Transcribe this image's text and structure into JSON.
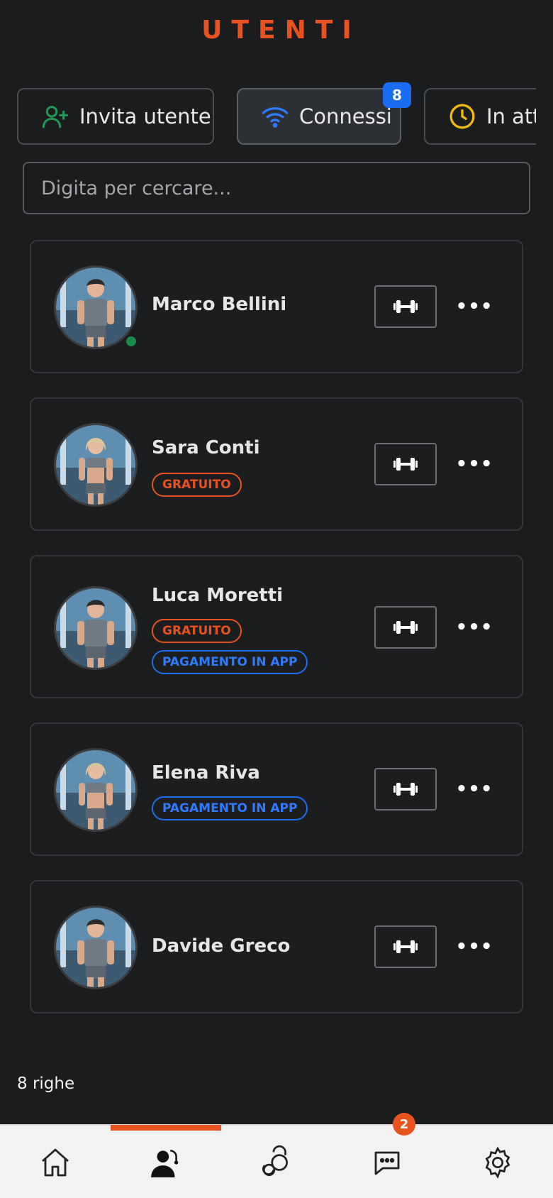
{
  "page": {
    "title": "UTENTI"
  },
  "tabs": {
    "invite_label": "Invita utente",
    "connected_label": "Connessi",
    "connected_count": "8",
    "waiting_label": "In attesa"
  },
  "search": {
    "placeholder": "Digita per cercare..."
  },
  "users": [
    {
      "name": "Marco Bellini",
      "online": true,
      "tags": []
    },
    {
      "name": "Sara Conti",
      "tags": [
        "GRATUITO"
      ]
    },
    {
      "name": "Luca Moretti",
      "tags": [
        "GRATUITO",
        "PAGAMENTO IN APP"
      ]
    },
    {
      "name": "Elena Riva",
      "tags": [
        "PAGAMENTO IN APP"
      ]
    },
    {
      "name": "Davide Greco",
      "tags": []
    }
  ],
  "footer": {
    "rows_count": "8 righe"
  },
  "nav": {
    "active": "users",
    "chat_badge": "2",
    "items": [
      "home-icon",
      "users-icon",
      "kettlebell-icon",
      "chat-icon",
      "settings-icon"
    ]
  },
  "colors": {
    "accent": "#e8521f",
    "blue": "#1a6cf0",
    "online": "#1b8a4a",
    "background": "#1b1c1e"
  }
}
